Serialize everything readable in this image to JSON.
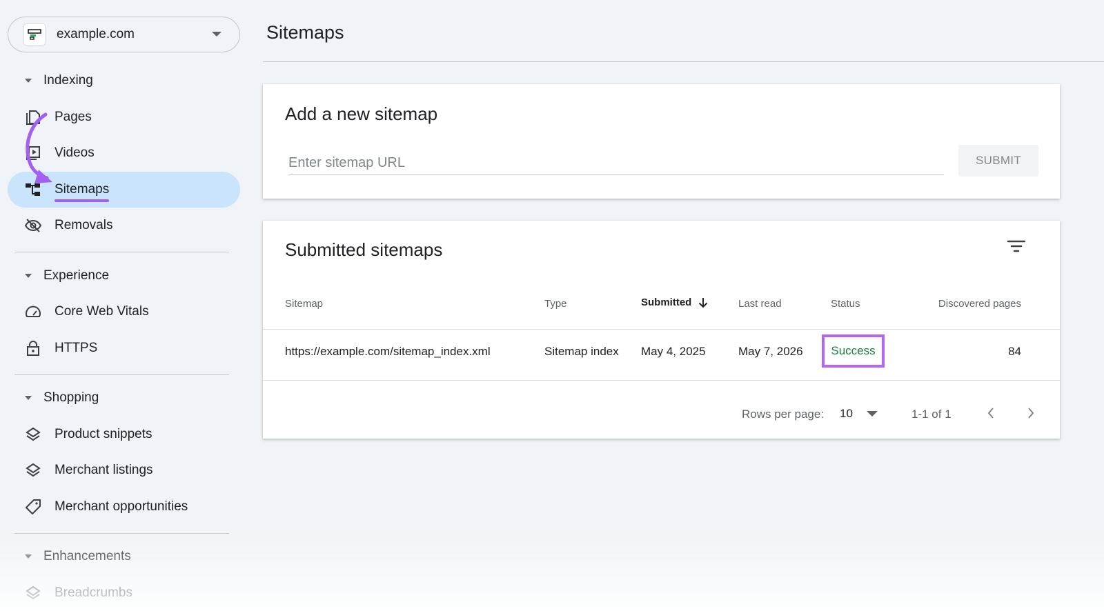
{
  "property": {
    "name": "example.com"
  },
  "sidebar": {
    "sections": [
      {
        "label": "Indexing",
        "items": [
          {
            "label": "Pages",
            "icon": "pages-icon"
          },
          {
            "label": "Videos",
            "icon": "videos-icon"
          },
          {
            "label": "Sitemaps",
            "icon": "sitemaps-icon",
            "active": true
          },
          {
            "label": "Removals",
            "icon": "removals-icon"
          }
        ]
      },
      {
        "label": "Experience",
        "items": [
          {
            "label": "Core Web Vitals",
            "icon": "speedometer-icon"
          },
          {
            "label": "HTTPS",
            "icon": "lock-icon"
          }
        ]
      },
      {
        "label": "Shopping",
        "items": [
          {
            "label": "Product snippets",
            "icon": "layers-icon"
          },
          {
            "label": "Merchant listings",
            "icon": "layers-icon"
          },
          {
            "label": "Merchant opportunities",
            "icon": "tag-icon"
          }
        ]
      },
      {
        "label": "Enhancements",
        "items": [
          {
            "label": "Breadcrumbs",
            "icon": "layers-icon"
          }
        ]
      }
    ]
  },
  "main": {
    "title": "Sitemaps",
    "add_card": {
      "title": "Add a new sitemap",
      "input_placeholder": "Enter sitemap URL",
      "input_value": "",
      "submit_label": "SUBMIT"
    },
    "list_card": {
      "title": "Submitted sitemaps",
      "columns": [
        "Sitemap",
        "Type",
        "Submitted",
        "Last read",
        "Status",
        "Discovered pages"
      ],
      "sorted_column": "Submitted",
      "rows": [
        {
          "sitemap": "https://example.com/sitemap_index.xml",
          "type": "Sitemap index",
          "submitted": "May 4, 2025",
          "last_read": "May 7, 2026",
          "status": "Success",
          "discovered_pages": "84"
        }
      ],
      "pagination": {
        "rows_per_page_label": "Rows per page:",
        "rows_per_page": "10",
        "range": "1-1 of 1"
      }
    }
  },
  "colors": {
    "active_nav": "#c9e4fb",
    "annotation": "#a35ff0",
    "success": "#188038"
  }
}
